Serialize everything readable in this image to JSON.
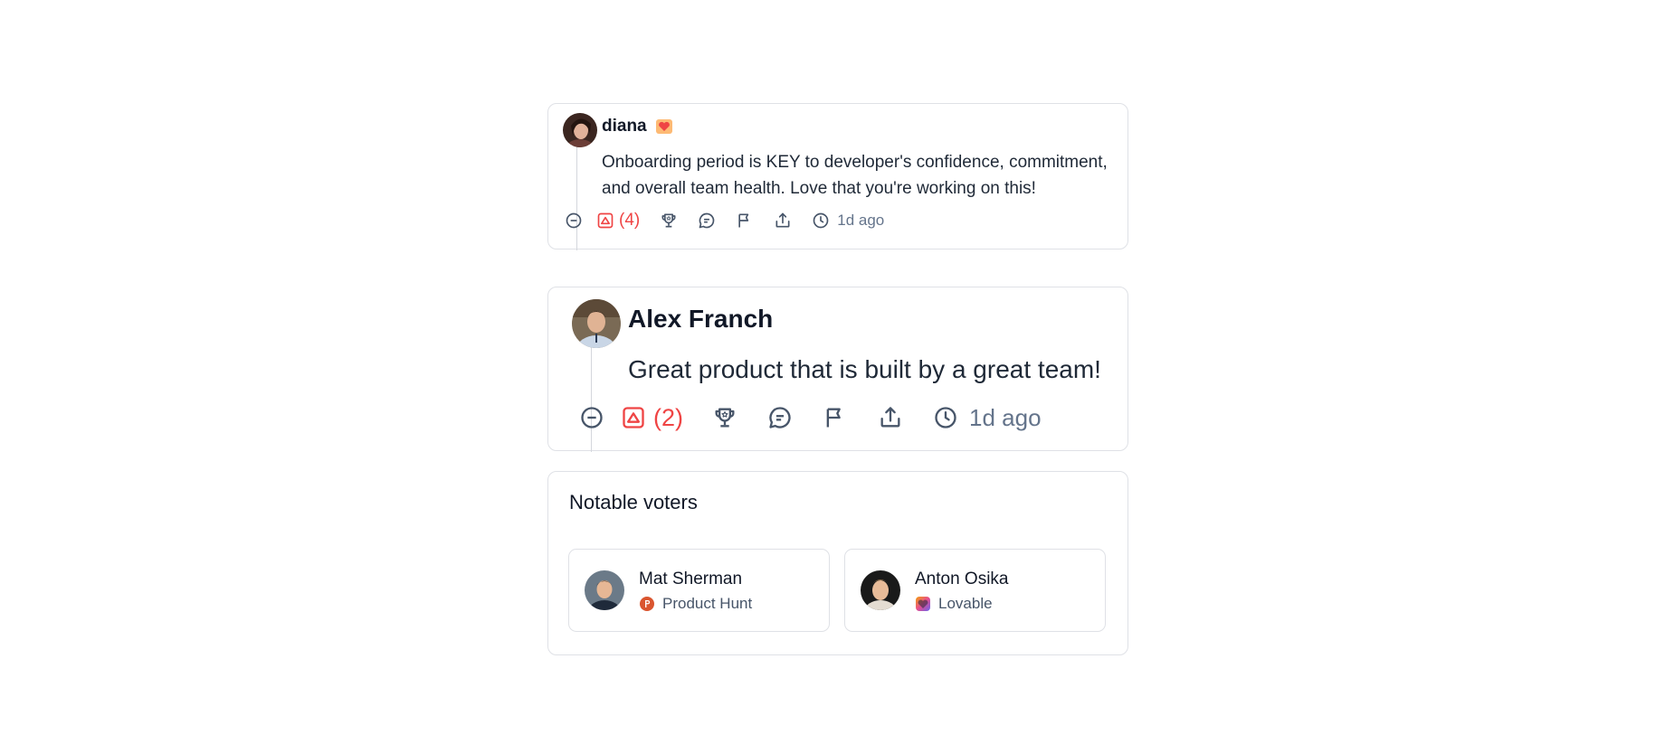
{
  "comments": [
    {
      "author": "diana",
      "badge_icon": "heart-badge-icon",
      "body": "Onboarding period is KEY to developer's confidence, commitment, and overall team health. Love that you're working on this!",
      "upvote_count": "(4)",
      "time": "1d ago"
    },
    {
      "author": "Alex Franch",
      "body": "Great product that is built by a great team!",
      "upvote_count": "(2)",
      "time": "1d ago"
    }
  ],
  "voters_section": {
    "title": "Notable voters",
    "voters": [
      {
        "name": "Mat Sherman",
        "org": "Product Hunt",
        "org_icon": "product-hunt-icon",
        "org_color": "#da552f"
      },
      {
        "name": "Anton Osika",
        "org": "Lovable",
        "org_icon": "lovable-icon",
        "org_color": "#e64d8f"
      }
    ]
  },
  "colors": {
    "upvote": "#ef4444",
    "icon": "#475569",
    "border": "#dfe1e6"
  }
}
